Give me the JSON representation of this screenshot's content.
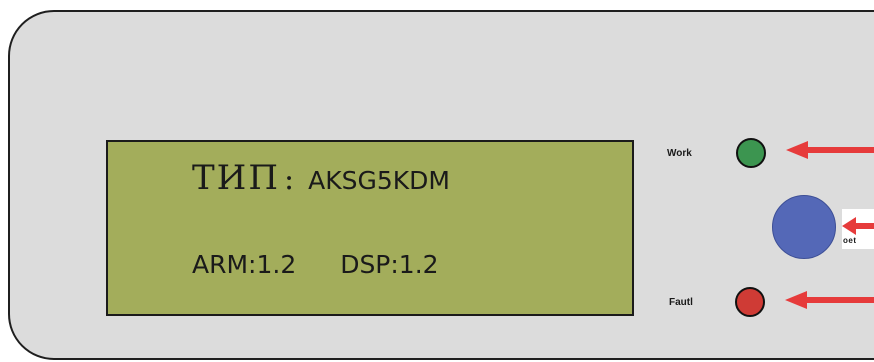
{
  "display": {
    "type_label": "ТИП",
    "type_colon": ":",
    "model_value": "AKSG5KDM",
    "arm_version": "ARM:1.2",
    "dsp_version": "DSP:1.2"
  },
  "indicators": {
    "work_label": "Work",
    "fault_label": "Fautl",
    "work_color": "#3c9550",
    "fault_color": "#cf3b35",
    "button_color": "#5468b7"
  },
  "callouts": {
    "button_partial_text": "oet",
    "arrow_color": "#e63b3b"
  }
}
